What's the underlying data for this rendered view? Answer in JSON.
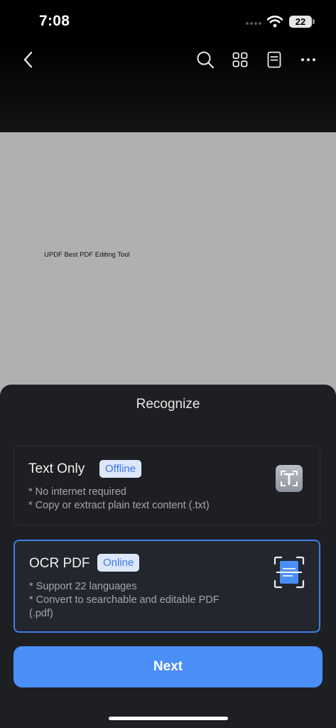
{
  "status_bar": {
    "time": "7:08",
    "battery": "22"
  },
  "toolbar": {
    "back_icon": "chevron-left-icon",
    "search_icon": "search-icon",
    "grid_icon": "grid-icon",
    "outline_icon": "document-outline-icon",
    "more_icon": "more-icon"
  },
  "document": {
    "text": "UPDF Best PDF Editing Tool"
  },
  "sheet": {
    "title": "Recognize",
    "options": [
      {
        "title": "Text Only",
        "badge": "Offline",
        "lines": [
          "* No internet required",
          "* Copy or extract plain text content (.txt)"
        ]
      },
      {
        "title": "OCR PDF",
        "badge": "Online",
        "lines": [
          "* Support 22 languages",
          "* Convert to searchable and editable PDF",
          "(.pdf)"
        ]
      }
    ],
    "next_label": "Next"
  },
  "colors": {
    "accent": "#4a8ef7",
    "selected_border": "#3f7ee8",
    "sheet_bg": "#1e1f22"
  }
}
